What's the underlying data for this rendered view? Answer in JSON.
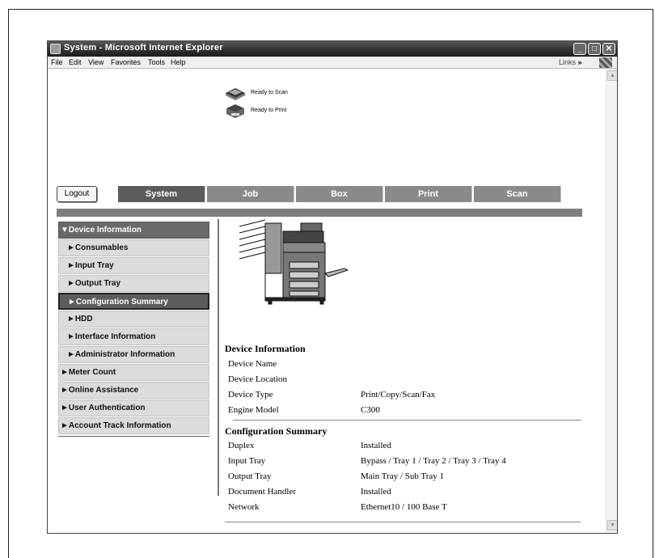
{
  "window": {
    "title": "System - Microsoft Internet Explorer",
    "buttons": {
      "minimize": "_",
      "maximize": "□",
      "close": "✕"
    }
  },
  "menubar": {
    "items": [
      "File",
      "Edit",
      "View",
      "Favorites",
      "Tools",
      "Help"
    ],
    "links_label": "Links",
    "chevron": "»"
  },
  "status": {
    "scan": "Ready to Scan",
    "print": "Ready to Print"
  },
  "logout_label": "Logout",
  "tabs": [
    {
      "label": "System",
      "active": true
    },
    {
      "label": "Job",
      "active": false
    },
    {
      "label": "Box",
      "active": false
    },
    {
      "label": "Print",
      "active": false
    },
    {
      "label": "Scan",
      "active": false
    }
  ],
  "sidebar": {
    "items": [
      {
        "label": "▼Device Information",
        "kind": "top"
      },
      {
        "label": "►Consumables",
        "kind": "sub"
      },
      {
        "label": "►Input Tray",
        "kind": "sub"
      },
      {
        "label": "►Output Tray",
        "kind": "sub"
      },
      {
        "label": "►Configuration Summary",
        "kind": "sub",
        "selected": true
      },
      {
        "label": "►HDD",
        "kind": "sub"
      },
      {
        "label": "►Interface Information",
        "kind": "sub"
      },
      {
        "label": "►Administrator Information",
        "kind": "sub"
      },
      {
        "label": "►Meter Count",
        "kind": "lvl1"
      },
      {
        "label": "►Online Assistance",
        "kind": "lvl1"
      },
      {
        "label": "►User Authentication",
        "kind": "lvl1"
      },
      {
        "label": "►Account Track Information",
        "kind": "lvl1"
      }
    ]
  },
  "device_info": {
    "title": "Device Information",
    "rows": [
      {
        "key": "Device Name",
        "value": ""
      },
      {
        "key": "Device Location",
        "value": ""
      },
      {
        "key": "Device Type",
        "value": "Print/Copy/Scan/Fax"
      },
      {
        "key": "Engine Model",
        "value": "C300"
      }
    ]
  },
  "config_summary": {
    "title": "Configuration Summary",
    "rows": [
      {
        "key": "Duplex",
        "value": "Installed"
      },
      {
        "key": "Input Tray",
        "value": "Bypass / Tray 1 / Tray 2 / Tray 3 / Tray 4"
      },
      {
        "key": "Output Tray",
        "value": "Main Tray / Sub Tray 1"
      },
      {
        "key": "Document Handler",
        "value": "Installed"
      },
      {
        "key": "Network",
        "value": "Ethernet10 / 100 Base T"
      }
    ]
  }
}
